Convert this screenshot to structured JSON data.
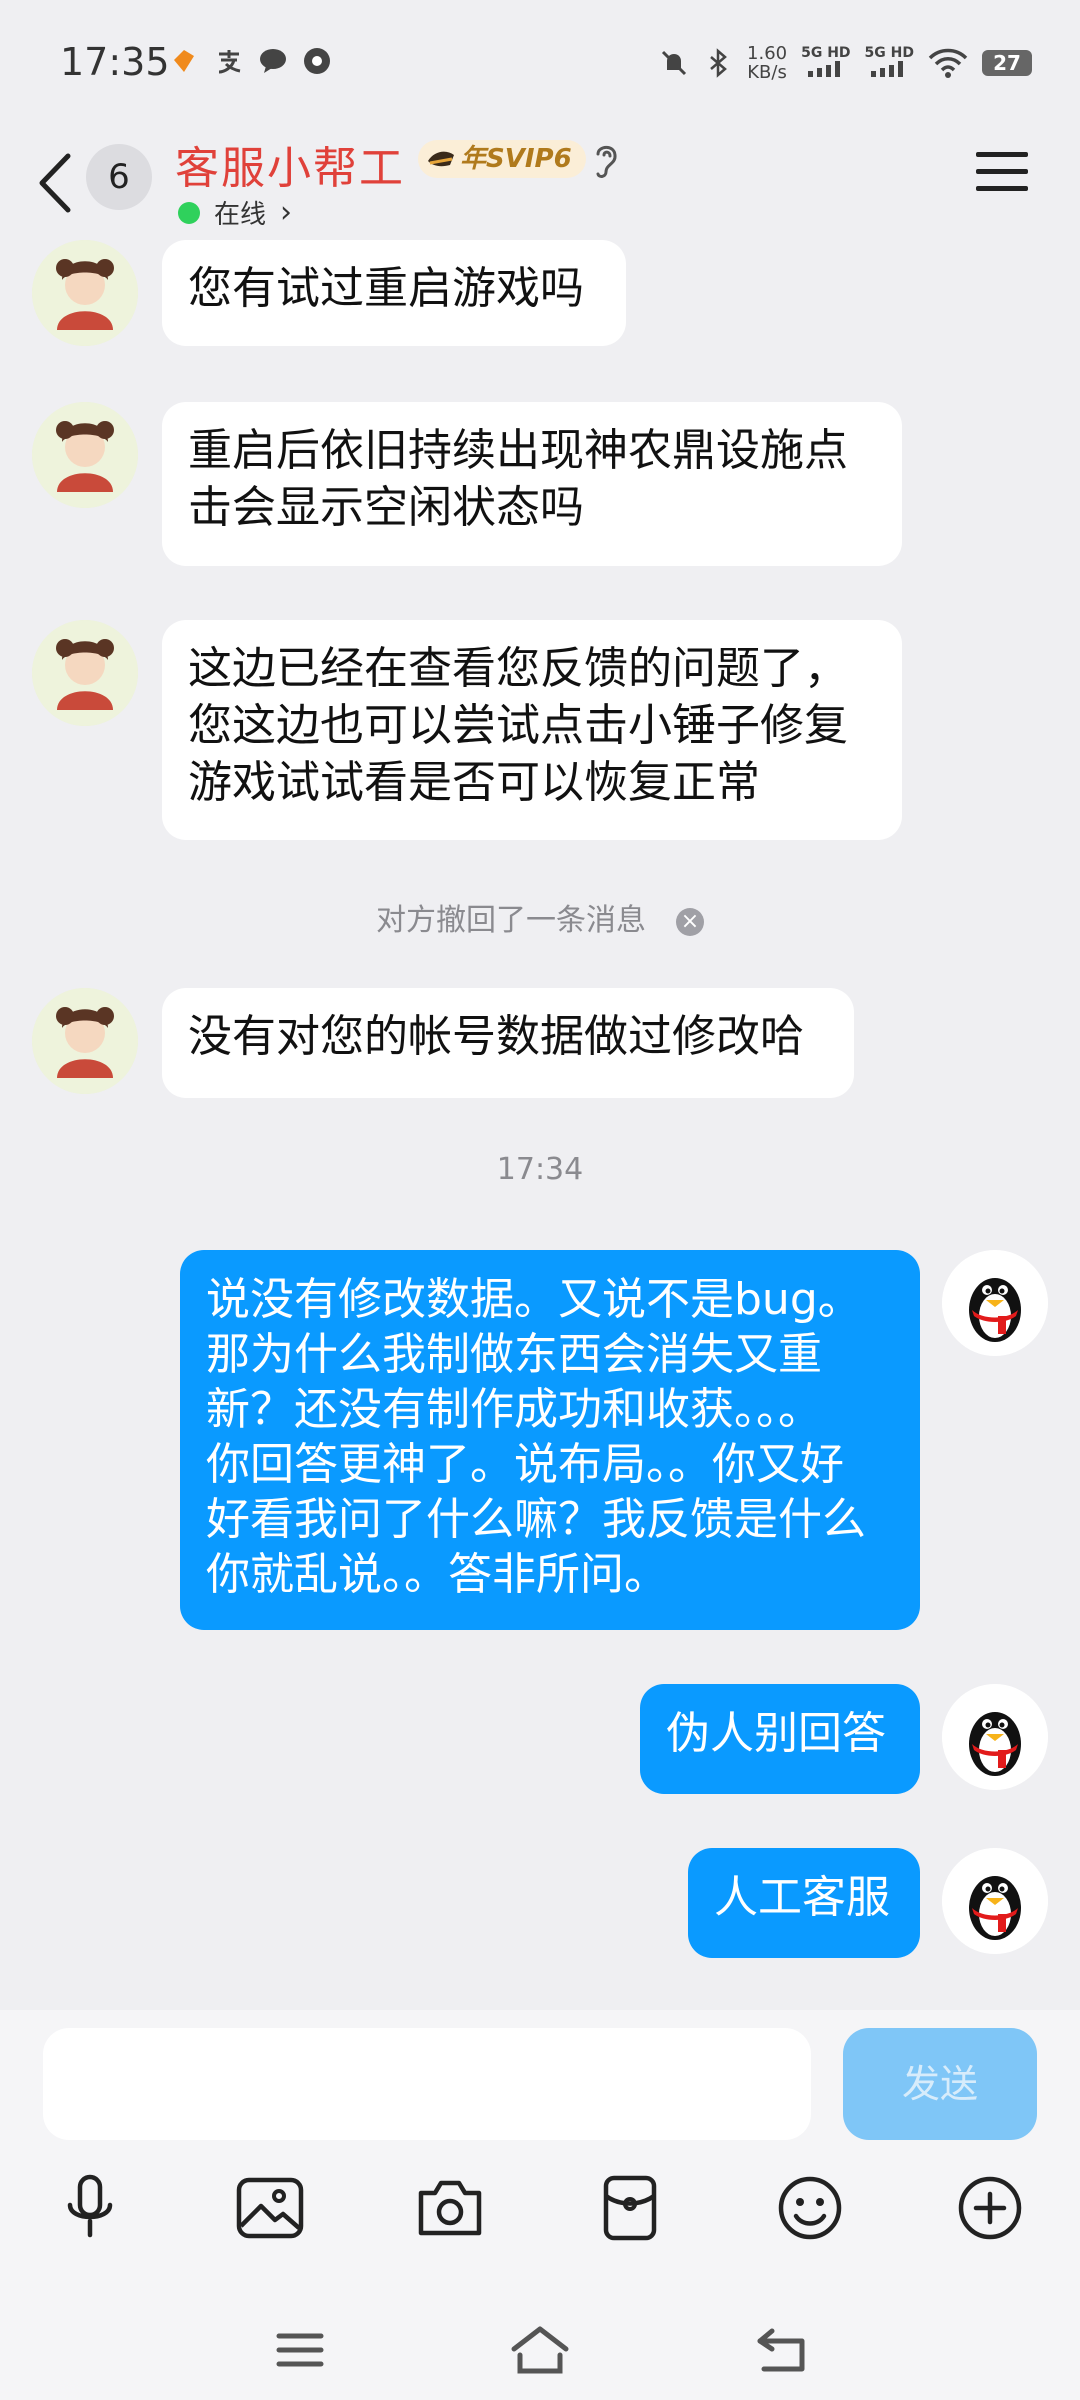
{
  "status_bar": {
    "time": "17:35",
    "net_speed_value": "1.60",
    "net_speed_unit": "KB/s",
    "sim1": "5G HD",
    "sim2": "5G HD",
    "battery": "27"
  },
  "header": {
    "unread_count": "6",
    "title": "客服小帮工",
    "vip_badge": "年SVIP6",
    "status": "在线",
    "status_chevron": "›"
  },
  "messages": [
    {
      "side": "left",
      "text_lines": [
        "您有试过重启游戏吗"
      ]
    },
    {
      "side": "left",
      "text_lines": [
        "重启后依旧持续出现神农鼎设施点",
        "击会显示空闲状态吗"
      ]
    },
    {
      "side": "left",
      "text_lines": [
        "这边已经在查看您反馈的问题了，",
        "您这边也可以尝试点击小锤子修复",
        "游戏试试看是否可以恢复正常"
      ]
    },
    {
      "side": "left",
      "text_lines": [
        "没有对您的帐号数据做过修改哈"
      ]
    },
    {
      "side": "right",
      "text_lines": [
        "说没有修改数据。又说不是bug。",
        "那为什么我制做东西会消失又重",
        "新？还没有制作成功和收获。。。",
        "你回答更神了。说布局。。你又好",
        "好看我问了什么嘛？我反馈是什么",
        "你就乱说。。答非所问。"
      ]
    },
    {
      "side": "right",
      "text_lines": [
        "伪人别回答"
      ]
    },
    {
      "side": "right",
      "text_lines": [
        "人工客服"
      ]
    }
  ],
  "system": {
    "recall_notice": "对方撤回了一条消息",
    "recall_close": "×",
    "timestamp": "17:34"
  },
  "input": {
    "placeholder": "",
    "send_label": "发送"
  },
  "toolbar_icons": [
    "microphone-icon",
    "image-icon",
    "camera-icon",
    "red-packet-icon",
    "emoji-icon",
    "plus-icon"
  ],
  "colors": {
    "title": "#e0413a",
    "outgoing_bubble": "#0a9aff",
    "send_button_disabled": "#7fc6f7",
    "online": "#2fd15c"
  }
}
